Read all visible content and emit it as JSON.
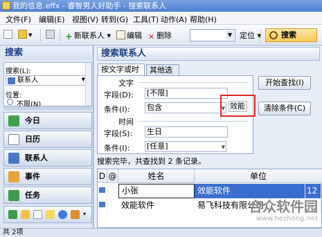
{
  "window": {
    "title": "我的信息.effx - 睿智男人好助手 - 搜索联系人"
  },
  "menu": [
    "文件(F)",
    "编辑(E)",
    "视图(V)",
    "转到(G)",
    "工具(T)",
    "动作(A)",
    "帮助(H)"
  ],
  "toolbar": {
    "new_contact": "新联系人",
    "edit": "编辑",
    "delete": "删除",
    "locate": "定位",
    "search": "搜索",
    "search_value": ""
  },
  "sidebar": {
    "header": "搜索",
    "search_label": "搜索(L):",
    "search_value": "联系人",
    "location_label": "位置:",
    "location_value": "不限(N)",
    "nav": [
      {
        "label": "今日",
        "icon": "today-icon"
      },
      {
        "label": "日历",
        "icon": "calendar-icon"
      },
      {
        "label": "联系人",
        "icon": "contacts-icon"
      },
      {
        "label": "事件",
        "icon": "events-icon"
      },
      {
        "label": "任务",
        "icon": "tasks-icon"
      }
    ]
  },
  "main": {
    "title": "搜索联系人",
    "tabs": [
      "按文字或时间",
      "其他选项"
    ],
    "text_group": "文字",
    "field_label": "字段(D):",
    "field_value": "[不限]",
    "condition_label": "条件(I):",
    "condition_value": "包含",
    "keyword_value": "效能",
    "time_group": "时间",
    "time_field_label": "字段(S):",
    "time_field_value": "生日",
    "time_condition_label": "条件(I):",
    "time_condition_value": "[任意]",
    "start_button": "开始查找(I)",
    "clear_button": "清除条件(C)",
    "status": "搜索完毕，共查找到 2 条记录。"
  },
  "grid": {
    "columns": [
      "D",
      "@",
      "姓名",
      "单位"
    ],
    "rows": [
      {
        "name": "小张",
        "company": "效能软件",
        "extra": "12",
        "selected": true
      },
      {
        "name": "效能软件",
        "company": "易飞科技有限公司",
        "extra": "",
        "selected": false
      }
    ]
  },
  "statusbar": {
    "text": "共 2项"
  },
  "watermark": {
    "line1": "合众软件园",
    "line2": "www.hezhong.net"
  },
  "colors": {
    "accent": "#1d3d82",
    "selection": "#3a6fcf",
    "highlight_box": "#e0251f"
  }
}
